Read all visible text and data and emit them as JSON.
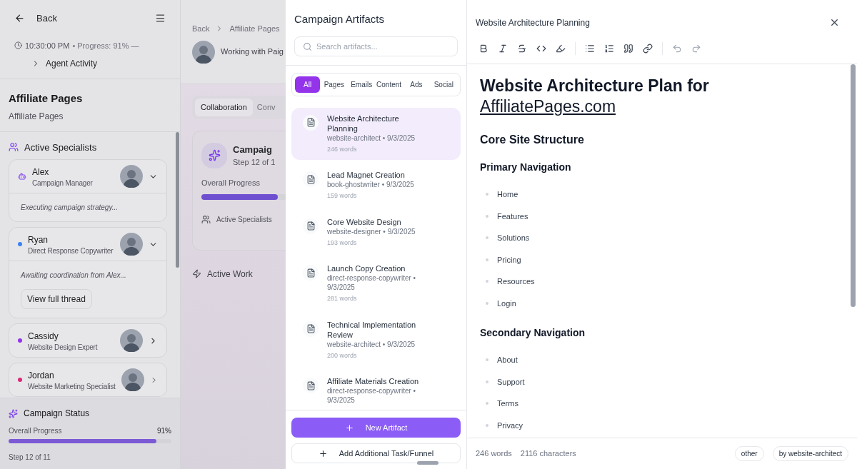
{
  "sidebar": {
    "back": "Back",
    "time": "10:30:00 PM",
    "progress_text": "• Progress: 91% —",
    "agent_activity": {
      "label": "Agent Activity",
      "expanded": false
    },
    "title": "Affiliate Pages",
    "subtitle": "Affiliate Pages",
    "specialists_heading": "Active Specialists",
    "specialists": [
      {
        "name": "Alex",
        "role": "Campaign Manager",
        "kind": "manager",
        "expanded": true,
        "status": "Executing campaign strategy..."
      },
      {
        "name": "Ryan",
        "role": "Direct Response Copywriter",
        "kind": "agent",
        "color": "#3b82f6",
        "expanded": true,
        "status": "Awaiting coordination from Alex...",
        "action": "View full thread"
      },
      {
        "name": "Cassidy",
        "role": "Website Design Expert",
        "kind": "agent",
        "color": "#9333ea",
        "expanded": false
      },
      {
        "name": "Jordan",
        "role": "Website Marketing Specialist",
        "kind": "agent",
        "color": "#db2777",
        "expanded": false
      }
    ],
    "status": {
      "heading": "Campaign Status",
      "label": "Overall Progress",
      "value": "91%",
      "level": 0.91,
      "step": "Step 12 of 11"
    }
  },
  "main": {
    "breadcrumbs": [
      "Back",
      "Affiliate Pages"
    ],
    "working_with": "Working with Paig",
    "tabs": [
      {
        "label": "Collaboration",
        "selected": true
      },
      {
        "label": "Conv",
        "selected": false
      }
    ],
    "card": {
      "title": "Campaig",
      "step": "Step 12 of 1",
      "progress_label": "Overall Progress",
      "level": 0.91,
      "specialists": "Active Specialists"
    },
    "active_work": "Active Work"
  },
  "artifacts": {
    "title": "Campaign Artifacts",
    "search": {
      "placeholder": "Search artifacts..."
    },
    "filters": [
      {
        "label": "All",
        "selected": true
      },
      {
        "label": "Pages",
        "selected": false
      },
      {
        "label": "Emails",
        "selected": false
      },
      {
        "label": "Content",
        "selected": false
      },
      {
        "label": "Ads",
        "selected": false
      },
      {
        "label": "Social",
        "selected": false
      }
    ],
    "items": [
      {
        "title": "Website Architecture Planning",
        "meta": "website-architect • 9/3/2025",
        "words": "246 words",
        "selected": true
      },
      {
        "title": "Lead Magnet Creation",
        "meta": "book-ghostwriter • 9/3/2025",
        "words": "159 words",
        "selected": false
      },
      {
        "title": "Core Website Design",
        "meta": "website-designer • 9/3/2025",
        "words": "193 words",
        "selected": false
      },
      {
        "title": "Launch Copy Creation",
        "meta": "direct-response-copywriter • 9/3/2025",
        "words": "281 words",
        "selected": false
      },
      {
        "title": "Technical Implementation Review",
        "meta": "website-architect • 9/3/2025",
        "words": "200 words",
        "selected": false
      },
      {
        "title": "Affiliate Materials Creation",
        "meta": "direct-response-copywriter • 9/3/2025",
        "selected": false
      }
    ],
    "new_button": "New Artifact",
    "add_button": "Add Additional Task/Funnel"
  },
  "editor": {
    "title": "Website Architecture Planning",
    "content": [
      {
        "kind": "h1",
        "text": "Website Architecture Plan for",
        "link": "AffiliatePages.com"
      },
      {
        "kind": "h2",
        "text": "Core Site Structure"
      },
      {
        "kind": "h3",
        "text": "Primary Navigation"
      },
      {
        "kind": "list",
        "items": [
          "Home",
          "Features",
          "Solutions",
          "Pricing",
          "Resources",
          "Login"
        ]
      },
      {
        "kind": "h3",
        "text": "Secondary Navigation"
      },
      {
        "kind": "list",
        "items": [
          "About",
          "Support",
          "Terms",
          "Privacy"
        ]
      }
    ],
    "words": "246 words",
    "characters": "2116 characters",
    "tags": [
      "other",
      "by website-architect"
    ]
  }
}
